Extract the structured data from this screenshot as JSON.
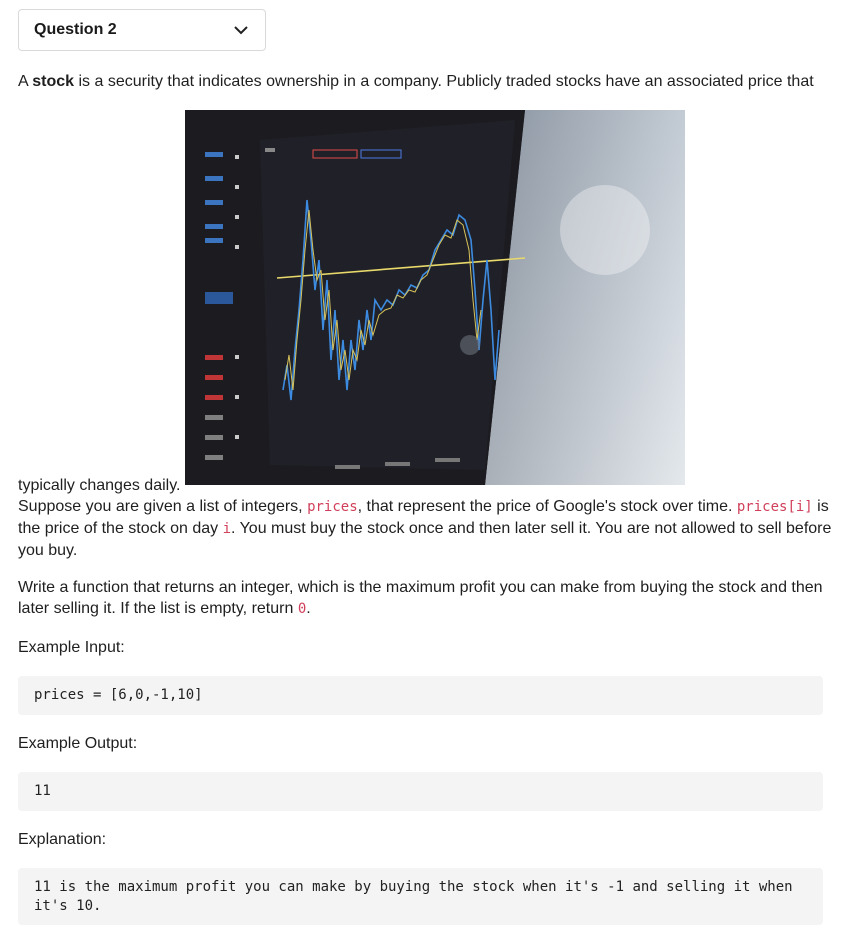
{
  "question_select": {
    "label": "Question 2",
    "icon": "chevron-down-icon"
  },
  "intro": {
    "text_a": "A ",
    "bold": "stock",
    "text_b": " is a security that indicates ownership in a company. Publicly traded stocks have an associated price that"
  },
  "image": {
    "icon": "stock-chart-photo"
  },
  "para2": {
    "t1": "typically changes daily.",
    "t2": "Suppose you are given a list of integers, ",
    "c1": "prices",
    "t3": ", that represent the price of Google's stock over time. ",
    "c2": "prices[i]",
    "t4": " is the price of the stock on day ",
    "c3": "i",
    "t5": ". You must buy the stock once and then later sell it. You are not allowed to sell before you buy."
  },
  "para3": {
    "t1": "Write a function that returns an integer, which is the maximum profit you can make from buying the stock and then later selling it. If the list is empty, return ",
    "c1": "0",
    "t2": "."
  },
  "example_input": {
    "heading": "Example Input:",
    "code": "prices = [6,0,-1,10]"
  },
  "example_output": {
    "heading": "Example Output:",
    "code": "11"
  },
  "explanation": {
    "heading": "Explanation:",
    "code": "11 is the maximum profit you can make by buying the stock when it's -1 and selling it when it's 10."
  }
}
